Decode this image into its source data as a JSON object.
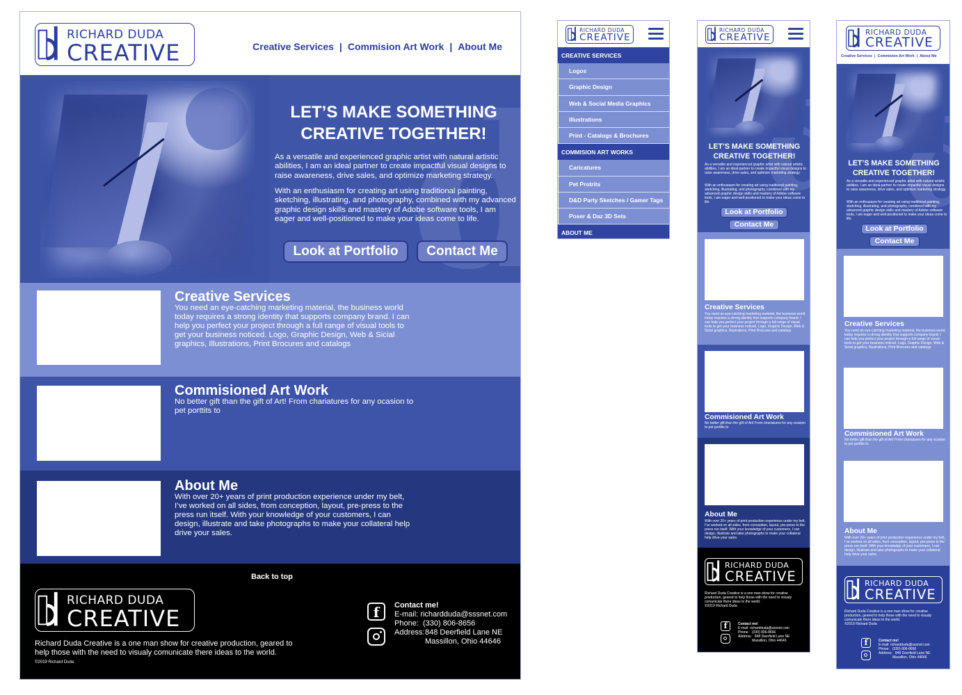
{
  "logo": {
    "top_line": "RICHARD DUDA",
    "bottom_line": "CREATIVE",
    "mark_icon": "rd-monogram-icon"
  },
  "desktop": {
    "nav": [
      "Creative Services",
      "Commision Art Work",
      "About Me"
    ],
    "nav_separator": "|",
    "hero": {
      "headline_line1": "LET’S MAKE SOMETHING",
      "headline_line2": "CREATIVE TOGETHER!",
      "para1": "As a versatile and experienced graphic artist with natural artistic abilities, I am an ideal partner to create impactful visual designs to raise awareness, drive sales, and optimize marketing strategy.",
      "para2": "With an enthusiasm for creating art using traditional painting, sketching, illustrating, and photography, combined with my advanced graphic design skills and mastery of Adobe software tools, I am eager and well-positioned to make your ideas come to life.",
      "btn_portfolio": "Look at Portfolio",
      "btn_contact": "Contact Me"
    },
    "sections": [
      {
        "title": "Creative Services",
        "body": "You need an eye-catching marketing material, the business world today requires a strong identity that supports company brand. I can help you perfect your project through a full range of visual tools to get your business noticed. Logo, Graphic Design, Web & Sicial graphics, Illustrations, Print Brocures and catalogs"
      },
      {
        "title": "Commisioned Art Work",
        "body": "No better gift than the gift of Art! From chariatures for any ocasion to pet porttits to"
      },
      {
        "title": "About Me",
        "body": "With over 20+ years of print production experience under my belt, I’ve worked on all sides, from conception, layout, pre-press to the press run itself. With your knowledge of your customers, I can design, illustrate and take photographs to make your collateral help drive your sales."
      }
    ],
    "footer": {
      "back_to_top": "Back to top",
      "blurb": "Richard Duda Creative is a one man show for creative production, geared to help those with the need to visualy comunicate there ideas to the world.",
      "copyright": "©2019 Richard Duda",
      "contact_heading": "Contact me!",
      "email_line": "E-mail: richardduda@sssnet.com",
      "phone_line": "Phone:  (330) 806-8656",
      "address_label": "Address:",
      "address_line1": "848 Deerfield Lane NE",
      "address_line2": "Massillon, Ohio 44646",
      "facebook_icon": "facebook-icon",
      "instagram_icon": "instagram-icon"
    }
  },
  "mobile_menu": {
    "items": [
      {
        "label": "CREATIVE SERVICES",
        "kind": "cat"
      },
      {
        "label": "Logos",
        "kind": "sub"
      },
      {
        "label": "Graphic Design",
        "kind": "sub"
      },
      {
        "label": "Web & Social Media Graphics",
        "kind": "sub"
      },
      {
        "label": "Illustrations",
        "kind": "sub"
      },
      {
        "label": "Print - Catalogs & Brochures",
        "kind": "sub"
      },
      {
        "label": "COMMISION ART WORKS",
        "kind": "cat"
      },
      {
        "label": "Caricatures",
        "kind": "sub"
      },
      {
        "label": "Pet Protrits",
        "kind": "sub"
      },
      {
        "label": "D&D Party Sketches / Gamer Tags",
        "kind": "sub"
      },
      {
        "label": "Poser & Daz 3D Sets",
        "kind": "sub"
      },
      {
        "label": "ABOUT ME",
        "kind": "cat"
      }
    ]
  },
  "mobile": {
    "headline_line1": "LET’S MAKE SOMETHING",
    "headline_line2": "CREATIVE TOGETHER!",
    "para1": "As a versatile and experienced graphic artist with natural artistic abilities, I am an ideal partner to create impactful visual designs to raise awareness, drive sales, and optimize marketing strategy.",
    "para2": "With an enthusiasm for creating art using traditional painting, sketching, illustrating, and photography, combined with my advanced graphic design skills and mastery of Adobe software tools, I am eager and well-positioned to make your ideas come to life.",
    "btn_portfolio": "Look at Portfolio",
    "btn_contact": "Contact Me",
    "sections": [
      {
        "title": "Creative Services",
        "body": "You need an eye-catching marketing material, the business world today requires a strong identity that supports company brand. I can help you perfect your project through a full range of visual tools to get your business noticed. Logo, Graphic Design, Web & Sicial graphics, Illustrations, Print Brocures and catalogs"
      },
      {
        "title": "Commisioned Art Work",
        "body": "No better gift than the gift of Art! From chariatures for any ocasion to pet porttits to"
      },
      {
        "title": "About Me",
        "body": "With over 20+ years of print production experience under my belt, I’ve worked on all sides, from conception, layout, pre-press to the press run itself. With your knowledge of your customers, I can design, illustrate and take photographs to make your collateral help drive your sales."
      }
    ],
    "footer_blurb": "Richard Duda Creative is a one man show for creative production, geared to help those with the need to visualy comunicate there ideas to the world.",
    "copyright": "©2019 Richard Duda",
    "contact_heading": "Contact me!",
    "email_line": "E-mail: richardduda@sssnet.com",
    "phone_line": "Phone:   (330) 806-8656",
    "address_line1": "Address:   848 Deerfield Lane NE",
    "address_line2": "Massillon, Ohio 44646"
  },
  "mobile_nav_compact": [
    "Creative Services",
    "Commision Art Work",
    "About Me"
  ],
  "colors": {
    "brand_blue": "#2a3d9c",
    "hero_blue": "#3b52a5",
    "light_section": "#7d8fd3",
    "mid_section": "#3d54a8",
    "dark_section": "#24377f",
    "footer": "#000000"
  }
}
